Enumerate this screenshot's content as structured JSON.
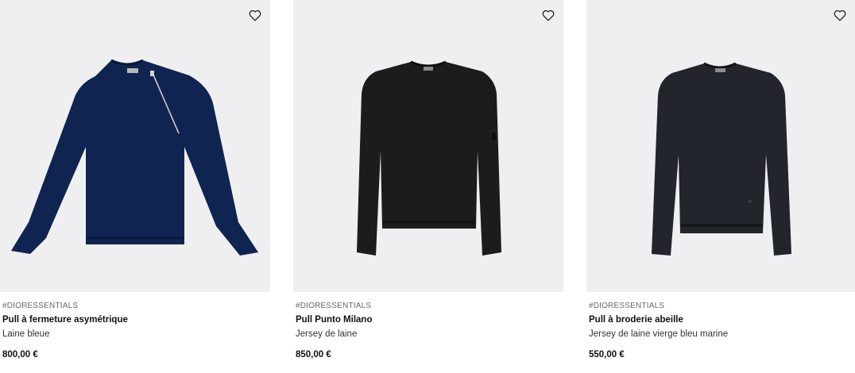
{
  "products": [
    {
      "tag": "#DIORESSENTIALS",
      "name": "Pull à fermeture asymétrique",
      "material": "Laine bleue",
      "price": "800,00 €",
      "color": "#0f2450"
    },
    {
      "tag": "#DIORESSENTIALS",
      "name": "Pull Punto Milano",
      "material": "Jersey de laine",
      "price": "850,00 €",
      "color": "#1c1c1c"
    },
    {
      "tag": "#DIORESSENTIALS",
      "name": "Pull à broderie abeille",
      "material": "Jersey de laine vierge bleu marine",
      "price": "550,00 €",
      "color": "#22252b"
    }
  ],
  "icons": {
    "favorite": "heart-outline-icon"
  },
  "colors": {
    "image_bg": "#efeff1"
  }
}
